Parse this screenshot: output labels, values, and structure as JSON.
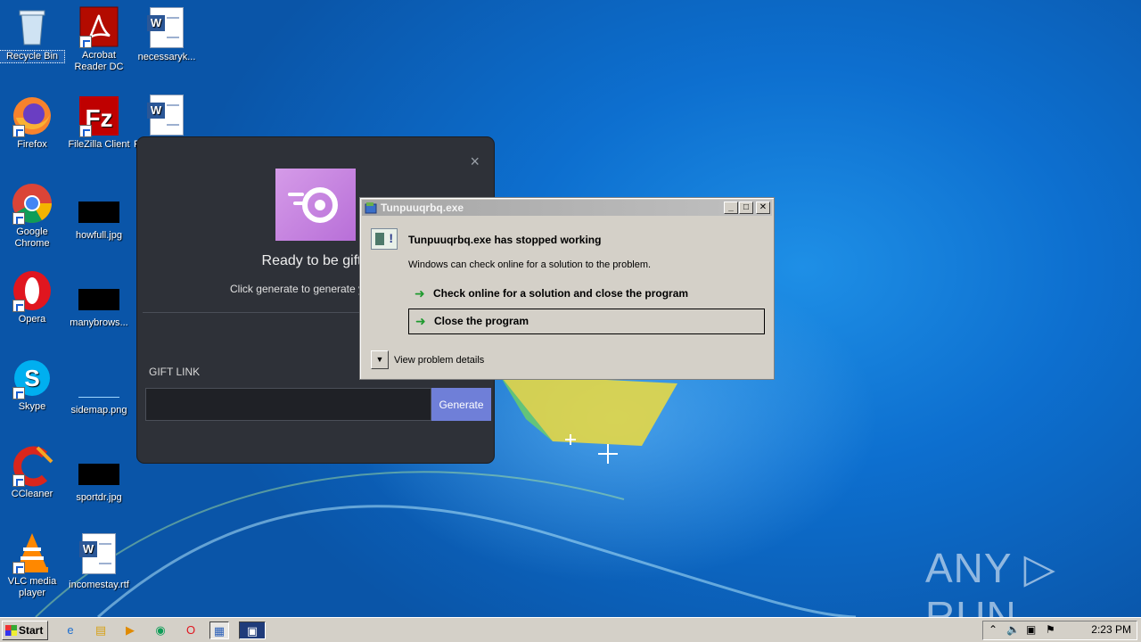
{
  "desktop": {
    "icons": [
      {
        "label": "Recycle Bin"
      },
      {
        "label": "Acrobat Reader DC"
      },
      {
        "label": "necessaryk..."
      },
      {
        "label": "Firefox"
      },
      {
        "label": "FileZilla Client"
      },
      {
        "label": "F"
      },
      {
        "label": "Google Chrome"
      },
      {
        "label": "howfull.jpg"
      },
      {
        "label": "Opera"
      },
      {
        "label": "manybrows..."
      },
      {
        "label": "Skype"
      },
      {
        "label": "sidemap.png"
      },
      {
        "label": "CCleaner"
      },
      {
        "label": "sportdr.jpg"
      },
      {
        "label": "VLC media player"
      },
      {
        "label": "incomestay.rtf"
      }
    ]
  },
  "generator": {
    "close_glyph": "×",
    "title": "Ready to be gifte",
    "subtitle": "Click generate to generate your Xbo",
    "gift_label": "GIFT LINK",
    "gift_value": "",
    "generate_label": "Generate"
  },
  "error_dialog": {
    "title": "Tunpuuqrbq.exe",
    "heading": "Tunpuuqrbq.exe has stopped working",
    "description": "Windows can check online for a solution to the problem.",
    "option_check_online": "Check online for a solution and close the program",
    "option_close": "Close the program",
    "details_label": "View problem details"
  },
  "taskbar": {
    "start_label": "Start",
    "clock": "2:23 PM"
  },
  "watermark": "ANY ▷ RUN"
}
